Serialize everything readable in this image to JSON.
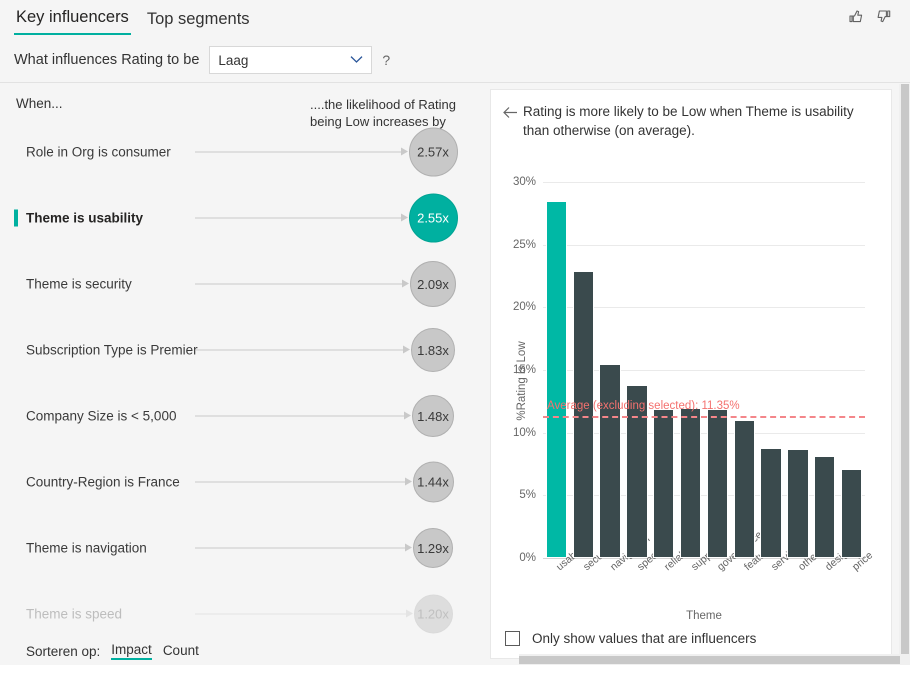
{
  "tabs": [
    {
      "label": "Key influencers",
      "active": true
    },
    {
      "label": "Top segments",
      "active": false
    }
  ],
  "feedback": {
    "up_icon": "thumbs-up-icon",
    "down_icon": "thumbs-down-icon"
  },
  "question": {
    "label": "What influences Rating to be",
    "dropdown_value": "Laag",
    "dropdown_icon": "chevron-down-icon",
    "help": "?"
  },
  "left_panel": {
    "when_header": "When...",
    "right_header": "....the likelihood of Rating being Low increases by",
    "influencers": [
      {
        "label": "Role in Org is consumer",
        "value": "2.57x",
        "selected": false,
        "faded": false,
        "size": 49
      },
      {
        "label": "Theme is usability",
        "value": "2.55x",
        "selected": true,
        "faded": false,
        "size": 49
      },
      {
        "label": "Theme is security",
        "value": "2.09x",
        "selected": false,
        "faded": false,
        "size": 46
      },
      {
        "label": "Subscription Type is Premier",
        "value": "1.83x",
        "selected": false,
        "faded": false,
        "size": 44
      },
      {
        "label": "Company Size is < 5,000",
        "value": "1.48x",
        "selected": false,
        "faded": false,
        "size": 42
      },
      {
        "label": "Country-Region is France",
        "value": "1.44x",
        "selected": false,
        "faded": false,
        "size": 41
      },
      {
        "label": "Theme is navigation",
        "value": "1.29x",
        "selected": false,
        "faded": false,
        "size": 40
      },
      {
        "label": "Theme is speed",
        "value": "1.20x",
        "selected": false,
        "faded": true,
        "size": 39
      }
    ],
    "sort": {
      "label": "Sorteren op:",
      "options": [
        {
          "label": "Impact",
          "active": true
        },
        {
          "label": "Count",
          "active": false
        }
      ]
    }
  },
  "right_panel": {
    "back_icon": "back-arrow-icon",
    "title": "Rating is more likely to be Low when Theme is usability than otherwise (on average).",
    "checkbox": {
      "label": "Only show values that are influencers",
      "checked": false
    }
  },
  "chart_data": {
    "type": "bar",
    "title": "",
    "categories": [
      "usability",
      "security",
      "navigation",
      "speed",
      "reliability",
      "support",
      "governance",
      "features",
      "services",
      "other",
      "design",
      "price"
    ],
    "values": [
      28.5,
      22.9,
      15.5,
      13.8,
      11.9,
      12.0,
      11.9,
      11.0,
      8.8,
      8.7,
      8.1,
      7.1
    ],
    "highlighted_category": "usability",
    "highlight_color": "#00b8a5",
    "bar_color": "#3a4a4d",
    "xlabel": "Theme",
    "ylabel": "%Rating is Low",
    "ylim": [
      0,
      30
    ],
    "yticks": [
      "0%",
      "5%",
      "10%",
      "15%",
      "20%",
      "25%",
      "30%"
    ],
    "ytick_values": [
      0,
      5,
      10,
      15,
      20,
      25,
      30
    ],
    "grid": true,
    "legend": "none",
    "reference_line": {
      "label": "Average (excluding selected): 11.35%",
      "value": 11.35,
      "color": "#f4868a",
      "style": "dashed"
    }
  },
  "scrollbars": {
    "vertical": "vertical-scrollbar",
    "horizontal": "horizontal-scrollbar"
  }
}
